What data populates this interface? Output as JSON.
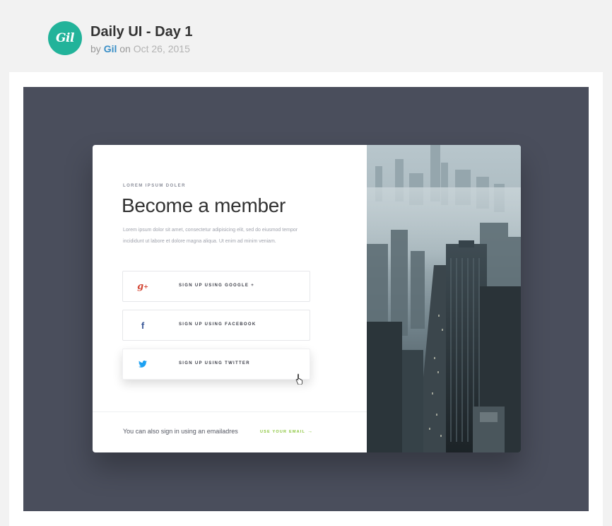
{
  "shot": {
    "avatar_text": "Gil",
    "title": "Daily UI - Day 1",
    "by": "by",
    "author": "Gil",
    "on": "on",
    "date": "Oct 26, 2015"
  },
  "card": {
    "eyebrow": "LOREM IPSUM DOLER",
    "headline": "Become a member",
    "description": "Lorem ipsum dolor sit amet, consectetur adipisicing elit, sed do eiusmod tempor incididunt ut labore et dolore magna aliqua. Ut enim ad minim veniam.",
    "buttons": [
      {
        "label": "SIGN UP USING GOOGLE +",
        "icon": "google-plus-icon"
      },
      {
        "label": "SIGN UP USING FACEBOOK",
        "icon": "facebook-icon"
      },
      {
        "label": "SIGN UP USING TWITTER",
        "icon": "twitter-icon"
      }
    ],
    "footer_text": "You can also sign in using an emailadres",
    "footer_link": "USE YOUR EMAIL"
  },
  "colors": {
    "page_bg": "#f2f2f2",
    "canvas_bg": "#4a4e5c",
    "avatar": "#22b39a",
    "author_link": "#3a8fc7",
    "google": "#d34836",
    "facebook": "#3b5998",
    "twitter": "#1da1f2",
    "accent_green": "#8cc63f"
  }
}
